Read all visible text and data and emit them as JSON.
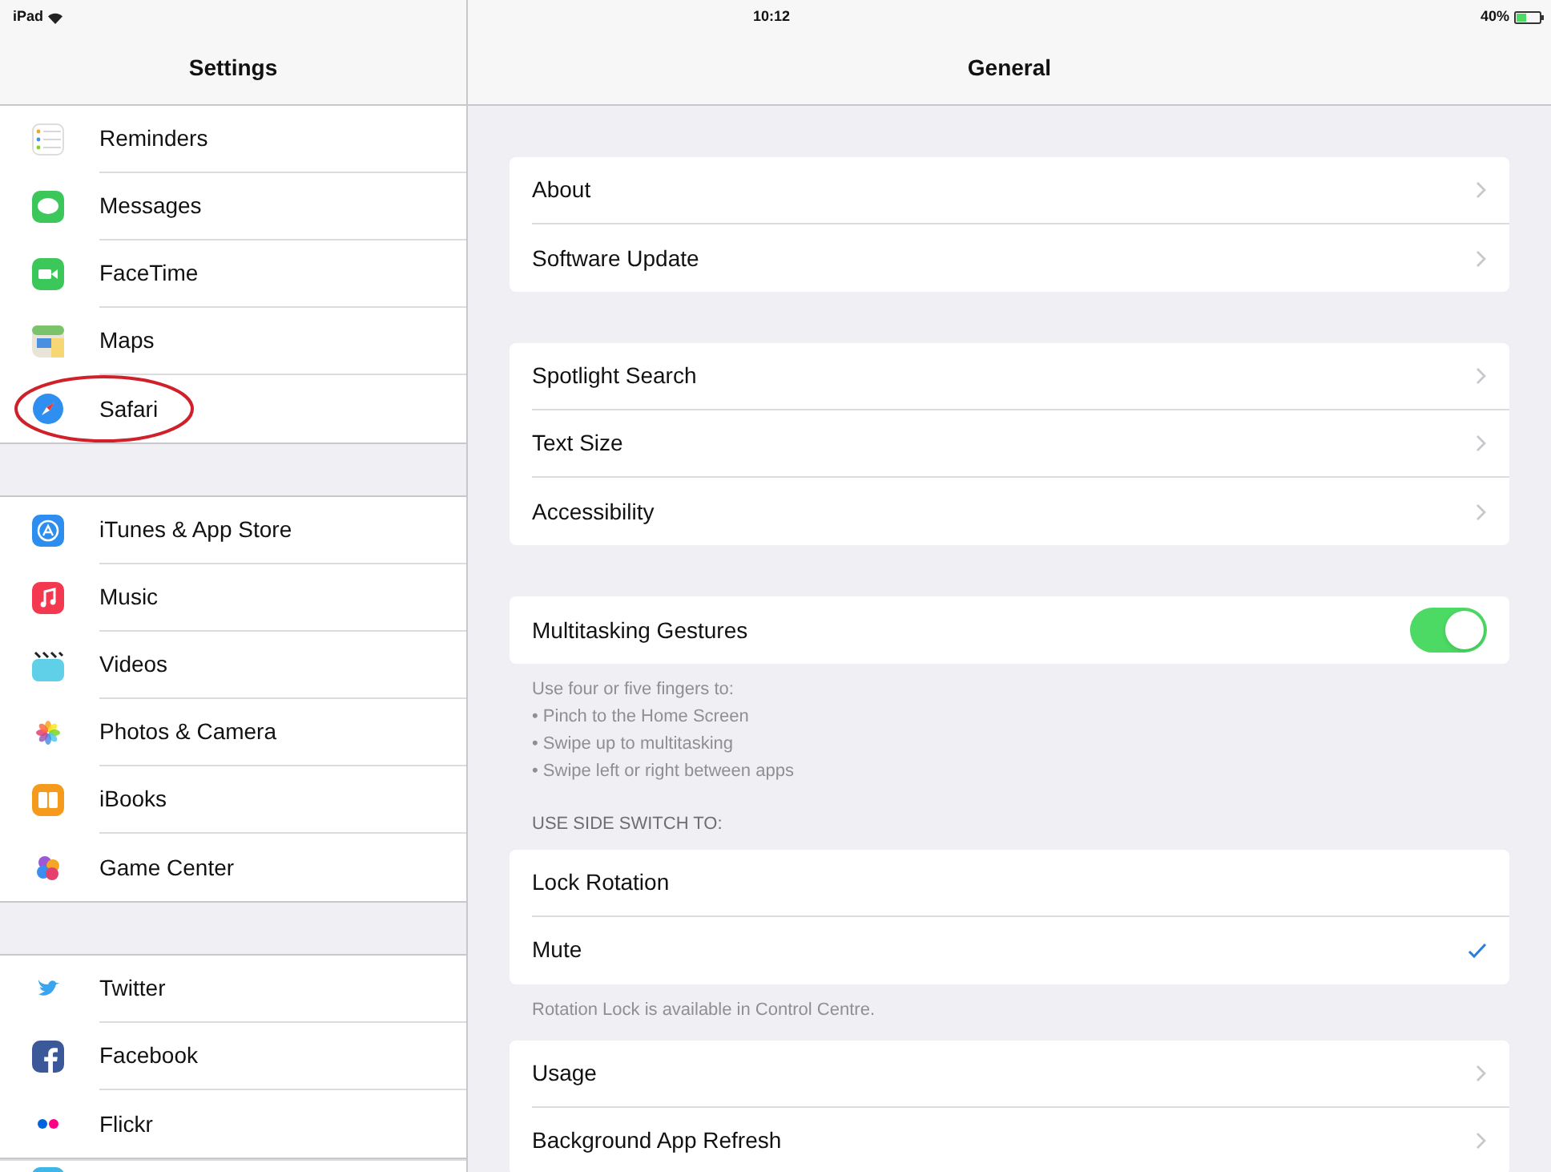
{
  "status_bar": {
    "device": "iPad",
    "time": "10:12",
    "battery": "40%"
  },
  "sidebar": {
    "title": "Settings",
    "sections": [
      {
        "items": [
          {
            "label": "Reminders",
            "circled": false
          },
          {
            "label": "Messages",
            "circled": false
          },
          {
            "label": "FaceTime",
            "circled": false
          },
          {
            "label": "Maps",
            "circled": false
          },
          {
            "label": "Safari",
            "circled": true
          }
        ]
      },
      {
        "items": [
          {
            "label": "iTunes & App Store",
            "circled": false
          },
          {
            "label": "Music",
            "circled": false
          },
          {
            "label": "Videos",
            "circled": false
          },
          {
            "label": "Photos & Camera",
            "circled": false
          },
          {
            "label": "iBooks",
            "circled": false
          },
          {
            "label": "Game Center",
            "circled": false
          }
        ]
      },
      {
        "items": [
          {
            "label": "Twitter",
            "circled": false
          },
          {
            "label": "Facebook",
            "circled": false
          },
          {
            "label": "Flickr",
            "circled": false
          }
        ]
      }
    ]
  },
  "detail": {
    "title": "General",
    "groups": [
      {
        "rows": [
          {
            "kind": "link",
            "label": "About"
          },
          {
            "kind": "link",
            "label": "Software Update"
          }
        ]
      },
      {
        "rows": [
          {
            "kind": "link",
            "label": "Spotlight Search"
          },
          {
            "kind": "link",
            "label": "Text Size"
          },
          {
            "kind": "link",
            "label": "Accessibility"
          }
        ]
      },
      {
        "rows": [
          {
            "kind": "toggle",
            "label": "Multitasking Gestures",
            "on": true
          }
        ],
        "footer": [
          "Use four or five fingers to:",
          "• Pinch to the Home Screen",
          "• Swipe up to multitasking",
          "• Swipe left or right between apps"
        ]
      },
      {
        "header": "USE SIDE SWITCH TO:",
        "rows": [
          {
            "kind": "check",
            "label": "Lock Rotation",
            "checked": false
          },
          {
            "kind": "check",
            "label": "Mute",
            "checked": true
          }
        ],
        "footer": [
          "Rotation Lock is available in Control Centre."
        ]
      },
      {
        "rows": [
          {
            "kind": "link",
            "label": "Usage"
          },
          {
            "kind": "link",
            "label": "Background App Refresh"
          }
        ]
      }
    ]
  }
}
